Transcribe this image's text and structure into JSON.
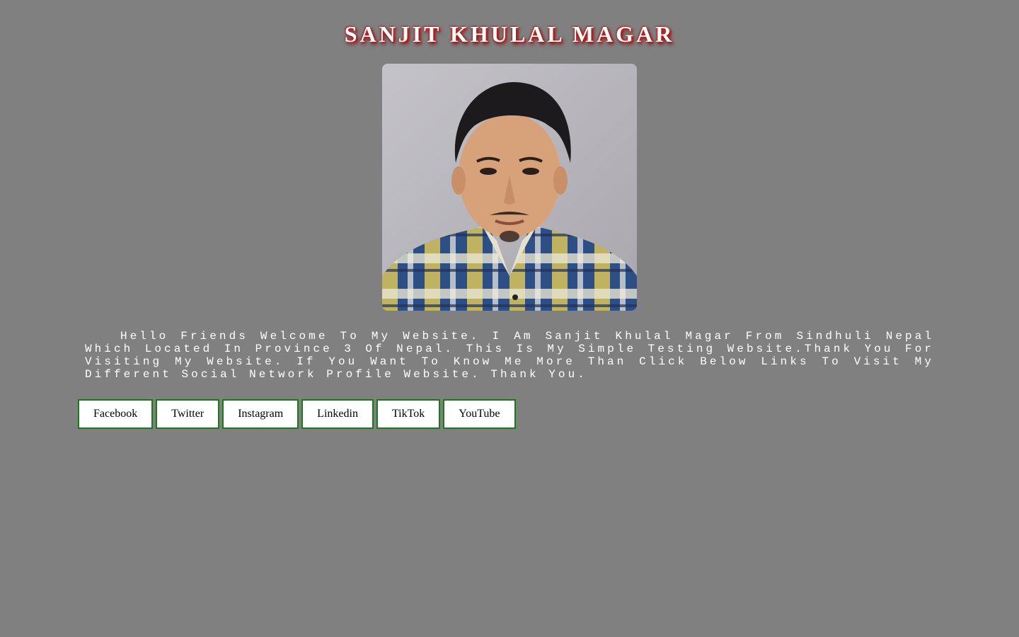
{
  "header": {
    "title": "SANJIT KHULAL MAGAR"
  },
  "profile_photo": {
    "alt": "profile-photo"
  },
  "bio": {
    "text": "Hello Friends Welcome To My Website. I Am Sanjit Khulal Magar From Sindhuli Nepal Which Located In Province 3 Of Nepal. This Is My Simple Testing Website.Thank You For Visiting My Website. If You Want To Know Me More Than Click Below Links To Visit My Different Social Network Profile Website. Thank You."
  },
  "social_links": [
    {
      "label": "Facebook"
    },
    {
      "label": "Twitter"
    },
    {
      "label": "Instagram"
    },
    {
      "label": "Linkedin"
    },
    {
      "label": "TikTok"
    },
    {
      "label": "YouTube"
    }
  ],
  "colors": {
    "background": "#808080",
    "title_shadow": "#cc1111",
    "button_border": "#1a7a1a"
  }
}
